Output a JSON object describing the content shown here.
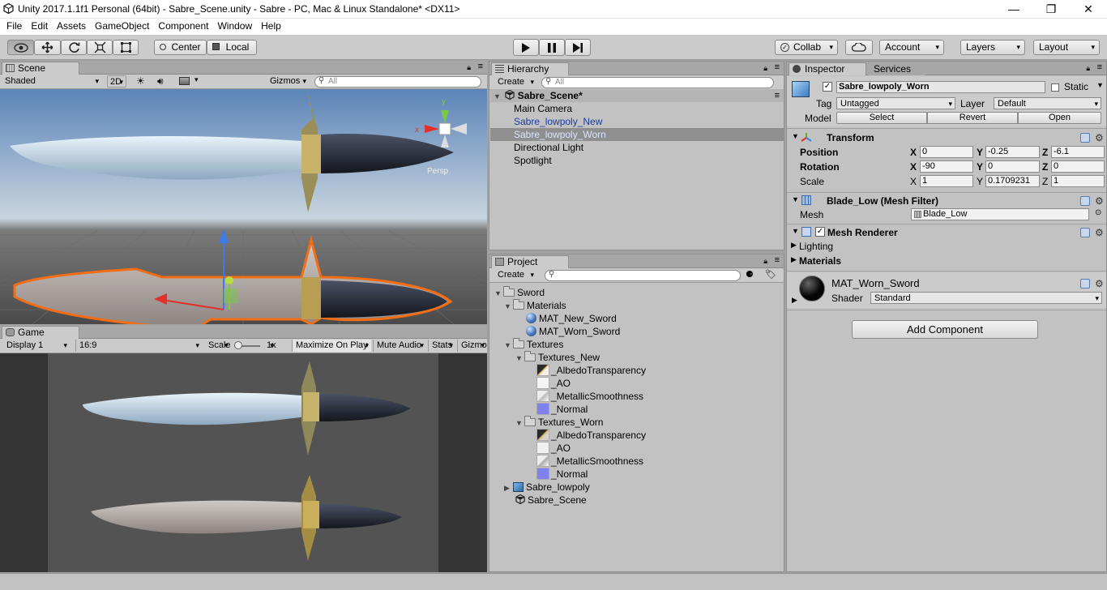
{
  "window": {
    "title": "Unity 2017.1.1f1 Personal (64bit) - Sabre_Scene.unity - Sabre - PC, Mac & Linux Standalone* <DX11>",
    "minimize": "—",
    "maximize": "❐",
    "close": "✕"
  },
  "menu": [
    "File",
    "Edit",
    "Assets",
    "GameObject",
    "Component",
    "Window",
    "Help"
  ],
  "toolbar": {
    "pivot_label": "Center",
    "space_label": "Local",
    "collab_label": "Collab",
    "account_label": "Account",
    "layers_label": "Layers",
    "layout_label": "Layout"
  },
  "scene": {
    "tab_label": "Scene",
    "shading": "Shaded",
    "mode_2d": "2D",
    "gizmos_label": "Gizmos",
    "search_placeholder": "All",
    "persp_label": "Persp",
    "gizmo_axes": [
      "y",
      "x"
    ]
  },
  "game": {
    "tab_label": "Game",
    "display": "Display 1",
    "aspect": "16:9",
    "scale_label": "Scale",
    "scale_value": "1x",
    "maximize_on_play": "Maximize On Play",
    "mute_audio": "Mute Audio",
    "stats": "Stats",
    "gizmos": "Gizmo"
  },
  "hierarchy": {
    "tab_label": "Hierarchy",
    "create_label": "Create",
    "search_placeholder": "All",
    "scene_name": "Sabre_Scene*",
    "items": [
      "Main Camera",
      "Sabre_lowpoly_New",
      "Sabre_lowpoly_Worn",
      "Directional Light",
      "Spotlight"
    ]
  },
  "project": {
    "tab_label": "Project",
    "create_label": "Create",
    "root": "Sword",
    "materials_folder": "Materials",
    "materials": [
      "MAT_New_Sword",
      "MAT_Worn_Sword"
    ],
    "textures_folder": "Textures",
    "textures_new_folder": "Textures_New",
    "textures_new": [
      "_AlbedoTransparency",
      "_AO",
      "_MetallicSmoothness",
      "_Normal"
    ],
    "textures_worn_folder": "Textures_Worn",
    "textures_worn": [
      "_AlbedoTransparency",
      "_AO",
      "_MetallicSmoothness",
      "_Normal"
    ],
    "prefab": "Sabre_lowpoly",
    "scene_asset": "Sabre_Scene"
  },
  "inspector": {
    "tab_label": "Inspector",
    "services_tab": "Services",
    "object_name": "Sabre_lowpoly_Worn",
    "static_label": "Static",
    "tag_label": "Tag",
    "tag_value": "Untagged",
    "layer_label": "Layer",
    "layer_value": "Default",
    "model_label": "Model",
    "select_btn": "Select",
    "revert_btn": "Revert",
    "open_btn": "Open",
    "transform": {
      "title": "Transform",
      "position_label": "Position",
      "rotation_label": "Rotation",
      "scale_label": "Scale",
      "axis_x": "X",
      "axis_y": "Y",
      "axis_z": "Z",
      "position": [
        "0",
        "-0.25",
        "-6.1"
      ],
      "rotation": [
        "-90",
        "0",
        "0"
      ],
      "scale": [
        "1",
        "0.1709231",
        "1"
      ]
    },
    "mesh_filter": {
      "title": "Blade_Low (Mesh Filter)",
      "mesh_label": "Mesh",
      "mesh_value": "Blade_Low"
    },
    "mesh_renderer": {
      "title": "Mesh Renderer",
      "lighting_label": "Lighting",
      "materials_label": "Materials"
    },
    "material": {
      "name": "MAT_Worn_Sword",
      "shader_label": "Shader",
      "shader_value": "Standard"
    },
    "add_component": "Add Component"
  },
  "colors": {
    "selection": "#8f8f8f",
    "prefab_text": "#1a3c9c",
    "selection_outline": "#f26d14"
  }
}
